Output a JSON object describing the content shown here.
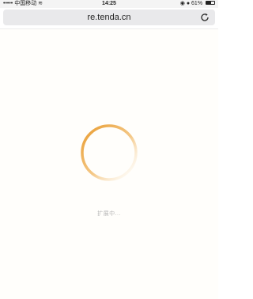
{
  "status_bar": {
    "carrier": "••••• 中国移动",
    "time": "14:25",
    "battery_percent": "61%",
    "battery_level": 0.61,
    "icons": [
      "wifi-icon",
      "location-icon",
      "alarm-icon",
      "battery-icon"
    ]
  },
  "browser": {
    "url": "re.tenda.cn",
    "reload_icon": "reload-icon"
  },
  "page": {
    "spinner_icon": "loading-spinner-icon",
    "loading_text": "扩展中...",
    "accent_color": "#e89a2c"
  }
}
